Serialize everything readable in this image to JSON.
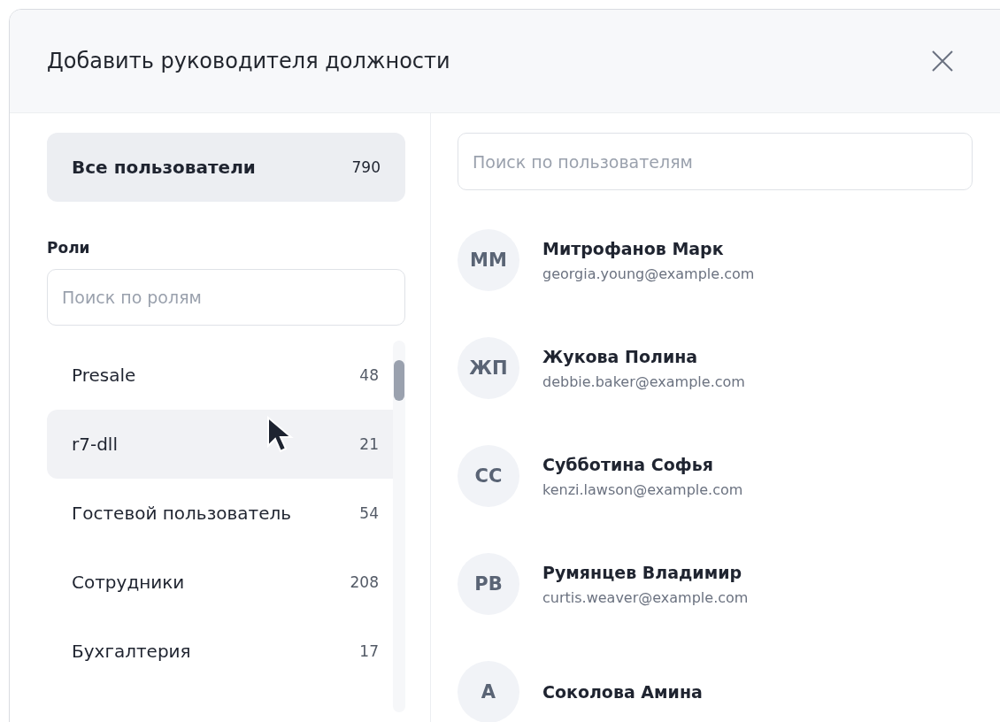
{
  "dialog": {
    "title": "Добавить руководителя должности"
  },
  "all_users": {
    "label": "Все пользователи",
    "count": "790",
    "selected": true
  },
  "roles": {
    "heading": "Роли",
    "search": {
      "placeholder": "Поиск по ролям"
    },
    "items": [
      {
        "name": "Presale",
        "count": "48",
        "hovered": false
      },
      {
        "name": "r7-dll",
        "count": "21",
        "hovered": true
      },
      {
        "name": "Гостевой пользователь",
        "count": "54",
        "hovered": false
      },
      {
        "name": "Сотрудники",
        "count": "208",
        "hovered": false
      },
      {
        "name": "Бухгалтерия",
        "count": "17",
        "hovered": false
      }
    ]
  },
  "users": {
    "search": {
      "placeholder": "Поиск по пользователям"
    },
    "items": [
      {
        "initials": "ММ",
        "name": "Митрофанов Марк",
        "email": "georgia.young@example.com"
      },
      {
        "initials": "ЖП",
        "name": "Жукова Полина",
        "email": "debbie.baker@example.com"
      },
      {
        "initials": "СС",
        "name": "Субботина Софья",
        "email": "kenzi.lawson@example.com"
      },
      {
        "initials": "РВ",
        "name": "Румянцев Владимир",
        "email": "curtis.weaver@example.com"
      },
      {
        "initials": "А",
        "name": "Соколова Амина"
      }
    ]
  }
}
